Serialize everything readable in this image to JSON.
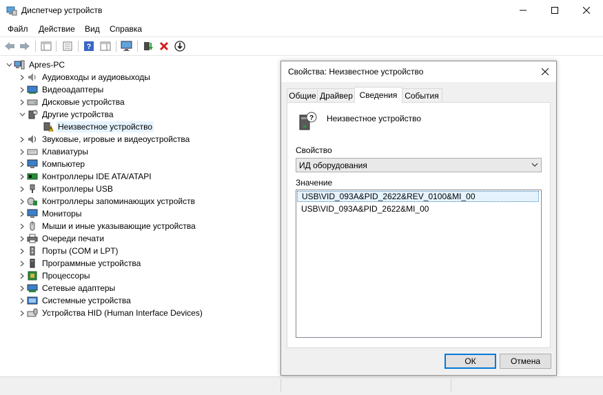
{
  "window": {
    "title": "Диспетчер устройств"
  },
  "menu": [
    "Файл",
    "Действие",
    "Вид",
    "Справка"
  ],
  "tree": {
    "root": "Apres-PC",
    "items": [
      {
        "label": "Аудиовходы и аудиовыходы",
        "icon": "speaker-icon"
      },
      {
        "label": "Видеоадаптеры",
        "icon": "display-adapter-icon"
      },
      {
        "label": "Дисковые устройства",
        "icon": "disk-drive-icon"
      },
      {
        "label": "Другие устройства",
        "icon": "other-devices-icon"
      },
      {
        "label": "Неизвестное устройство",
        "icon": "unknown-device-warning-icon"
      },
      {
        "label": "Звуковые, игровые и видеоустройства",
        "icon": "sound-icon"
      },
      {
        "label": "Клавиатуры",
        "icon": "keyboard-icon"
      },
      {
        "label": "Компьютер",
        "icon": "computer-icon"
      },
      {
        "label": "Контроллеры IDE ATA/ATAPI",
        "icon": "ide-controller-icon"
      },
      {
        "label": "Контроллеры USB",
        "icon": "usb-icon"
      },
      {
        "label": "Контроллеры запоминающих устройств",
        "icon": "storage-controller-icon"
      },
      {
        "label": "Мониторы",
        "icon": "monitor-icon"
      },
      {
        "label": "Мыши и иные указывающие устройства",
        "icon": "mouse-icon"
      },
      {
        "label": "Очереди печати",
        "icon": "printer-icon"
      },
      {
        "label": "Порты (COM и LPT)",
        "icon": "port-icon"
      },
      {
        "label": "Программные устройства",
        "icon": "software-device-icon"
      },
      {
        "label": "Процессоры",
        "icon": "processor-icon"
      },
      {
        "label": "Сетевые адаптеры",
        "icon": "network-adapter-icon"
      },
      {
        "label": "Системные устройства",
        "icon": "system-devices-icon"
      },
      {
        "label": "Устройства HID (Human Interface Devices)",
        "icon": "hid-icon"
      }
    ]
  },
  "dialog": {
    "title": "Свойства: Неизвестное устройство",
    "tabs": [
      "Общие",
      "Драйвер",
      "Сведения",
      "События"
    ],
    "active_tab": "Сведения",
    "device_name": "Неизвестное устройство",
    "property_label": "Свойство",
    "property_value": "ИД оборудования",
    "value_label": "Значение",
    "values": [
      "USB\\VID_093A&PID_2622&REV_0100&MI_00",
      "USB\\VID_093A&PID_2622&MI_00"
    ],
    "ok_label": "ОК",
    "cancel_label": "Отмена"
  },
  "colors": {
    "accent": "#0078d7",
    "selection": "#e5f3ff",
    "dialog_bg": "#f0f0f0"
  }
}
